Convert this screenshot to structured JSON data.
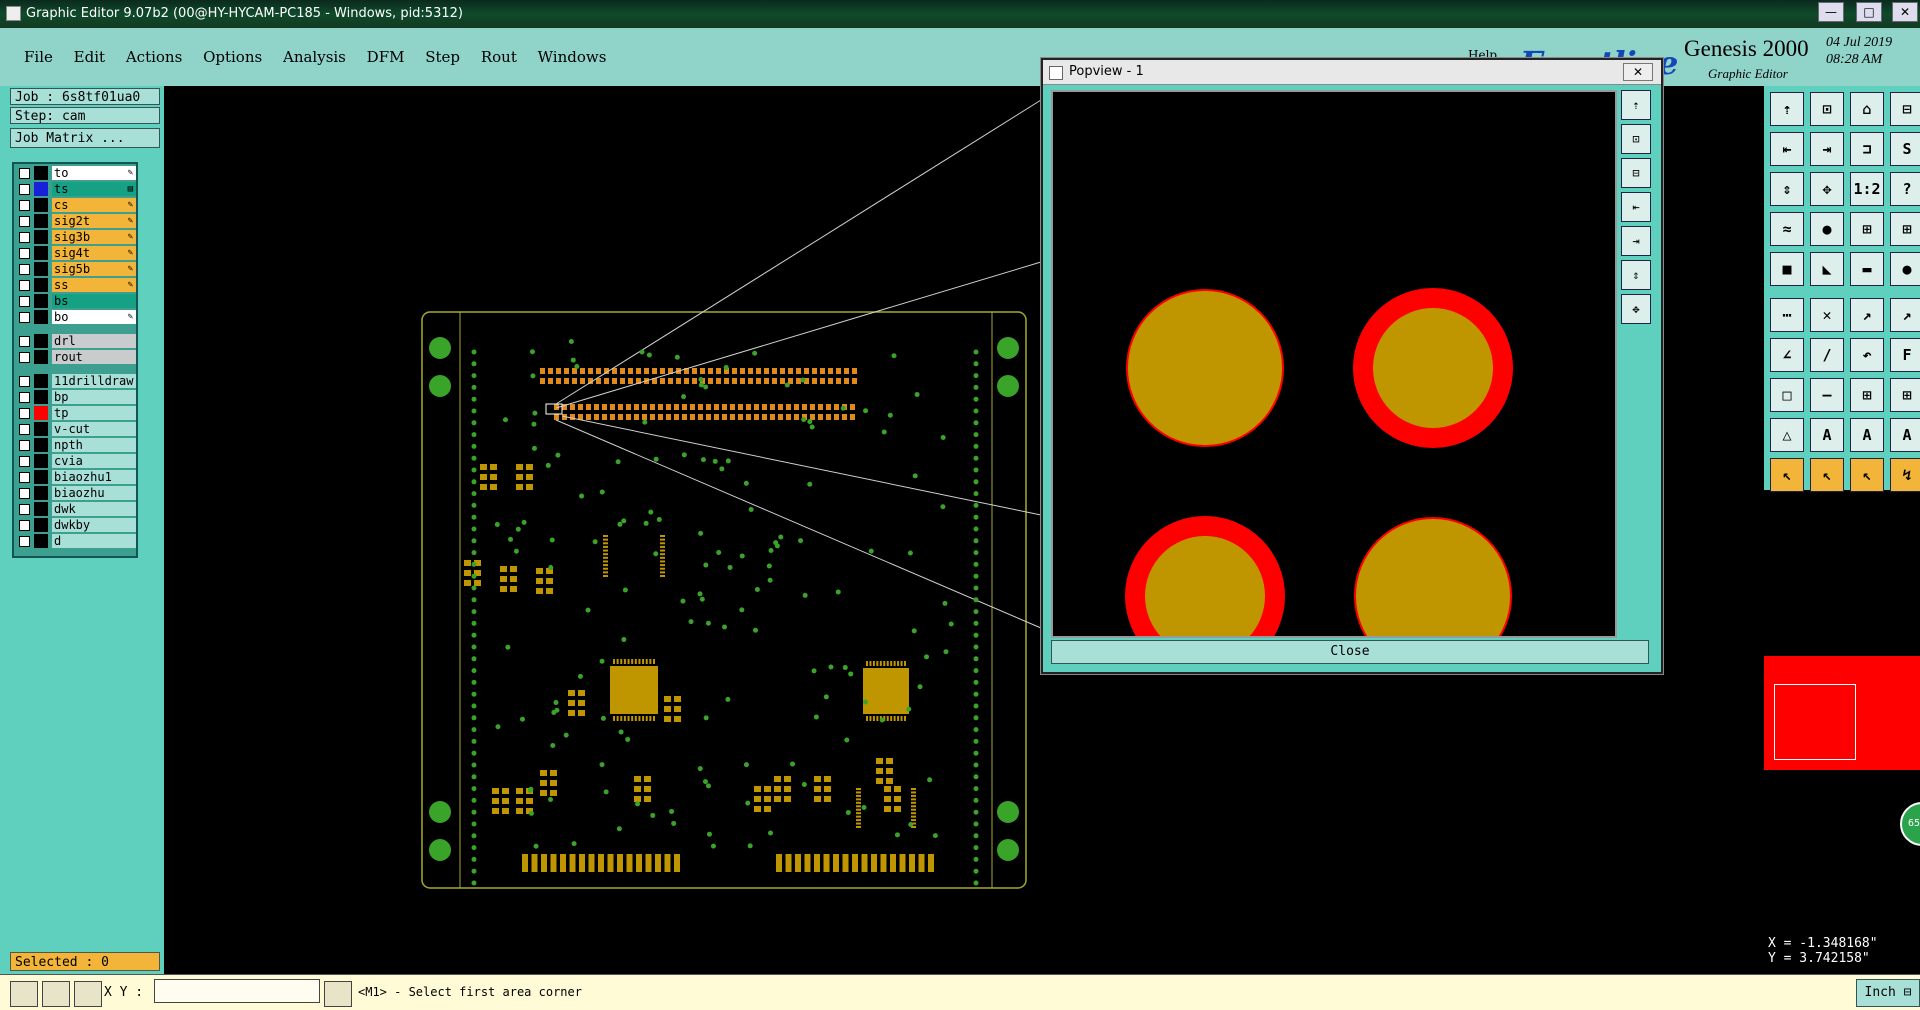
{
  "window": {
    "title": "Graphic Editor 9.07b2 (00@HY-HYCAM-PC185 - Windows, pid:5312)",
    "minimize": "—",
    "maximize": "□",
    "close": "✕"
  },
  "menu": {
    "items": [
      "File",
      "Edit",
      "Actions",
      "Options",
      "Analysis",
      "DFM",
      "Step",
      "Rout",
      "Windows"
    ],
    "help": "Help"
  },
  "brand": {
    "logo": "Frontline",
    "product": "Genesis 2000",
    "subtitle": "Graphic Editor",
    "date": "04 Jul 2019",
    "time": "08:28 AM"
  },
  "job": {
    "job": "Job : 6s8tf01ua0",
    "step": "Step: cam",
    "matrix_button": "Job Matrix ..."
  },
  "layers": [
    {
      "name": "to",
      "color": "#ffffff",
      "swatch": "#000000",
      "mark": "✎"
    },
    {
      "name": "ts",
      "color": "#17a184",
      "swatch": "#1820d8",
      "mark": "▤"
    },
    {
      "name": "cs",
      "color": "#f3b43a",
      "swatch": "#000000",
      "mark": "✎"
    },
    {
      "name": "sig2t",
      "color": "#f3b43a",
      "swatch": "#000000",
      "mark": "✎"
    },
    {
      "name": "sig3b",
      "color": "#f3b43a",
      "swatch": "#000000",
      "mark": "✎"
    },
    {
      "name": "sig4t",
      "color": "#f3b43a",
      "swatch": "#000000",
      "mark": "✎"
    },
    {
      "name": "sig5b",
      "color": "#f3b43a",
      "swatch": "#000000",
      "mark": "✎"
    },
    {
      "name": "ss",
      "color": "#f3b43a",
      "swatch": "#000000",
      "mark": "✎"
    },
    {
      "name": "bs",
      "color": "#17a184",
      "swatch": "#000000",
      "mark": ""
    },
    {
      "name": "bo",
      "color": "#ffffff",
      "swatch": "#000000",
      "mark": "✎"
    },
    {
      "name": "drl",
      "color": "#c8cccc",
      "swatch": "#000000",
      "mark": ""
    },
    {
      "name": "rout",
      "color": "#c8cccc",
      "swatch": "#000000",
      "mark": ""
    },
    {
      "name": "11drilldraw",
      "color": "#a8e0d8",
      "swatch": "#000000",
      "mark": ""
    },
    {
      "name": "bp",
      "color": "#a8e0d8",
      "swatch": "#000000",
      "mark": ""
    },
    {
      "name": "tp",
      "color": "#a8e0d8",
      "swatch": "#ff0000",
      "mark": ""
    },
    {
      "name": "v-cut",
      "color": "#a8e0d8",
      "swatch": "#000000",
      "mark": ""
    },
    {
      "name": "npth",
      "color": "#a8e0d8",
      "swatch": "#000000",
      "mark": ""
    },
    {
      "name": "cvia",
      "color": "#a8e0d8",
      "swatch": "#000000",
      "mark": ""
    },
    {
      "name": "biaozhu1",
      "color": "#a8e0d8",
      "swatch": "#000000",
      "mark": ""
    },
    {
      "name": "biaozhu",
      "color": "#a8e0d8",
      "swatch": "#000000",
      "mark": ""
    },
    {
      "name": "dwk",
      "color": "#a8e0d8",
      "swatch": "#000000",
      "mark": ""
    },
    {
      "name": "dwkby",
      "color": "#a8e0d8",
      "swatch": "#000000",
      "mark": ""
    },
    {
      "name": "d",
      "color": "#a8e0d8",
      "swatch": "#000000",
      "mark": ""
    }
  ],
  "status": {
    "selected": "Selected : 0",
    "xy_label": "X Y :",
    "xy_value": "",
    "prompt": "<M1> - Select first area corner",
    "units": "Inch ⊟"
  },
  "coords": {
    "x": "X = -1.348168\"",
    "y": "Y = 3.742158\""
  },
  "popview": {
    "title": "Popview - 1",
    "close_x": "✕",
    "close_button": "Close"
  },
  "tools": [
    "⇡",
    "⊡",
    "⌂",
    "⊟",
    "⇤",
    "⇥",
    "⊐",
    "S",
    "⇕",
    "✥",
    "1:2",
    "?",
    "≈",
    "●",
    "⊞",
    "⊞",
    "■",
    "◣",
    "▬",
    "●",
    "⋯",
    "✕",
    "↗",
    "↗",
    "∠",
    "/",
    "↶",
    "F",
    "□",
    "—",
    "⊞",
    "⊞",
    "△",
    "A",
    "A",
    "A",
    "↖",
    "↖",
    "↖",
    "↯"
  ],
  "colors": {
    "panel": "#5fcfbe",
    "pad": "#c09600",
    "ring": "#ff0000",
    "board": "#a7a92a"
  }
}
